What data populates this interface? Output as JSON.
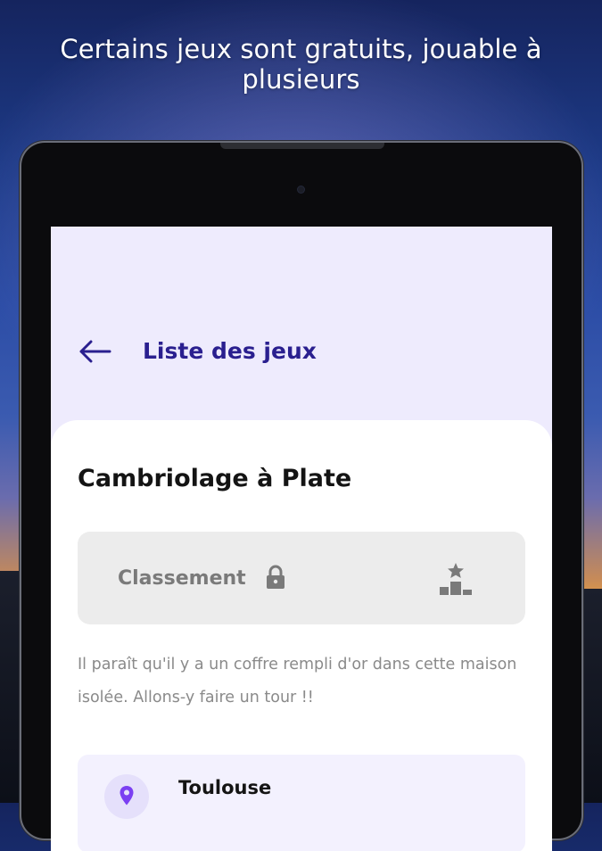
{
  "caption": "Certains jeux sont gratuits, jouable à plusieurs",
  "header": {
    "title": "Liste des jeux",
    "back_icon": "arrow-left-icon"
  },
  "game": {
    "title": "Cambriolage à Plate",
    "ranking_label": "Classement",
    "lock_icon": "lock-icon",
    "podium_icon": "podium-icon",
    "description": "Il paraît qu'il y a un coffre rempli d'or dans cette maison isolée. Allons-y faire un tour !!",
    "location": "Toulouse",
    "location_icon": "map-pin-icon"
  },
  "colors": {
    "accent": "#2a1f8f",
    "screen_bg": "#eeebfd",
    "pin": "#7b3ff2"
  }
}
